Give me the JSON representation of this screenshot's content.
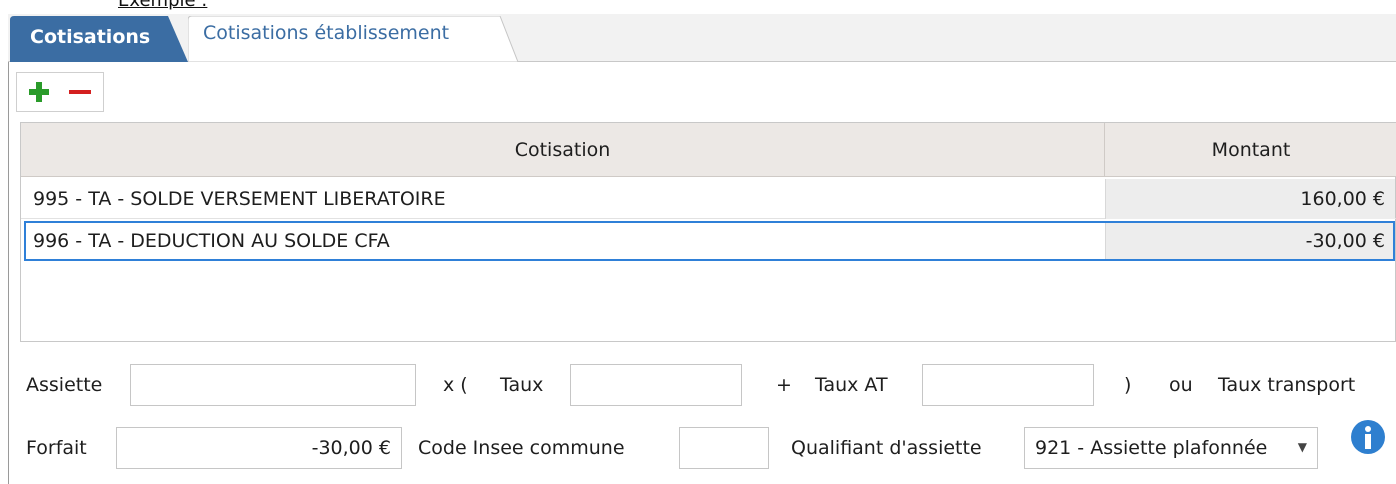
{
  "page_heading_fragment": "Exemple :",
  "tabs": [
    {
      "label": "Cotisations",
      "active": true
    },
    {
      "label": "Cotisations établissement",
      "active": false
    }
  ],
  "toolbar": {
    "add_icon": "plus-icon",
    "remove_icon": "minus-icon"
  },
  "grid": {
    "columns": [
      "Cotisation",
      "Montant"
    ],
    "rows": [
      {
        "cotisation": "995 - TA - SOLDE VERSEMENT LIBERATOIRE",
        "montant": "160,00 €",
        "selected": false
      },
      {
        "cotisation": "996 - TA - DEDUCTION AU SOLDE CFA",
        "montant": "-30,00 €",
        "selected": true
      }
    ]
  },
  "form": {
    "assiette": {
      "label": "Assiette",
      "value": ""
    },
    "x_paren": "x (",
    "taux": {
      "label": "Taux",
      "value": ""
    },
    "plus": "+",
    "taux_at": {
      "label": "Taux AT",
      "value": ""
    },
    "close_paren": ")",
    "ou": "ou",
    "taux_transport": {
      "label": "Taux transport"
    },
    "forfait": {
      "label": "Forfait",
      "value": "-30,00 €"
    },
    "code_insee": {
      "label": "Code Insee commune",
      "value": ""
    },
    "qualifiant": {
      "label": "Qualifiant d'assiette",
      "value": "921 - Assiette plafonnée"
    }
  },
  "colors": {
    "active_tab": "#3b6da3",
    "selection": "#2f80d8",
    "add": "#2a9b2a",
    "remove": "#d42020",
    "info": "#2e7fcf"
  },
  "icons": {
    "dropdown": "chevron-down-icon",
    "info": "info-icon"
  }
}
